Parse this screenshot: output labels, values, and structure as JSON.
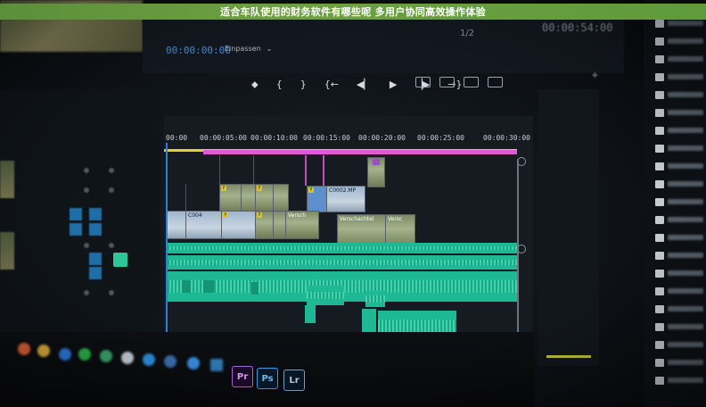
{
  "banner": {
    "title": "适合车队使用的财务软件有哪些呢 多用户协同高效操作体验"
  },
  "monitor": {
    "timecode": "00:00:00:00",
    "fit_label": "Einpassen",
    "fraction": "1/2",
    "timecode_right": "00:00:54:00"
  },
  "timeline": {
    "ruler": [
      "00:00",
      "00:00:05:00",
      "00:00:10:00",
      "00:00:15:00",
      "00:00:20:00",
      "00:00:25:00",
      "00:00:30:00"
    ],
    "clips": {
      "c0002": "C0002.MP",
      "c004": "C004",
      "versch1": "Versch",
      "versch2": "Verschachtel",
      "versch3": "Versc"
    }
  },
  "taskbar": {
    "pr": "Pr",
    "ps": "Ps",
    "lr": "Lr"
  },
  "colors": {
    "banner": "#6da043",
    "playhead": "#2f7fd8",
    "audio": "#1fb894",
    "marker": "#e05bd3"
  }
}
